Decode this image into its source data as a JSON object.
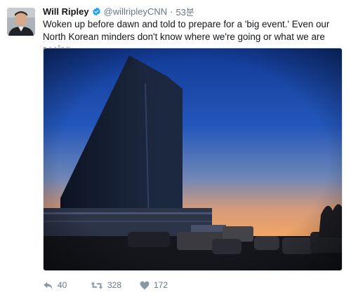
{
  "tweet": {
    "author_name": "Will Ripley",
    "handle": "@willripleyCNN",
    "separator": "·",
    "timestamp": "53분",
    "text": "Woken up before dawn and told to prepare for a 'big event.' Even our North Korean minders don't know where we're going or what we are seeing"
  },
  "actions": {
    "replies": "40",
    "retweets": "328",
    "likes": "172"
  },
  "icons": {
    "verified": "verified-badge-icon",
    "reply": "reply-icon",
    "retweet": "retweet-icon",
    "like": "heart-icon"
  },
  "colors": {
    "verified": "#1da1f2",
    "muted": "#657786",
    "text": "#14171a"
  }
}
